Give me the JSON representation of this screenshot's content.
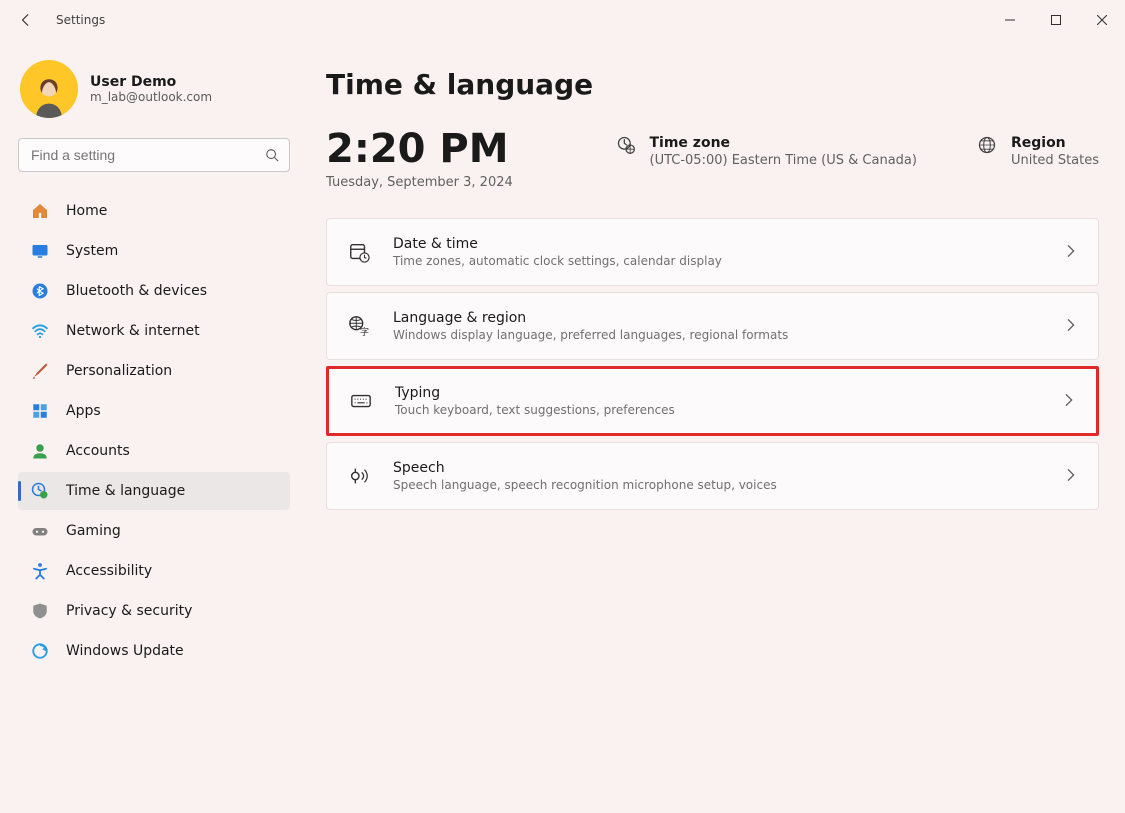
{
  "window": {
    "title": "Settings"
  },
  "profile": {
    "name": "User Demo",
    "email": "m_lab@outlook.com"
  },
  "search": {
    "placeholder": "Find a setting"
  },
  "nav": {
    "items": [
      {
        "id": "home",
        "label": "Home"
      },
      {
        "id": "system",
        "label": "System"
      },
      {
        "id": "bluetooth",
        "label": "Bluetooth & devices"
      },
      {
        "id": "network",
        "label": "Network & internet"
      },
      {
        "id": "personalization",
        "label": "Personalization"
      },
      {
        "id": "apps",
        "label": "Apps"
      },
      {
        "id": "accounts",
        "label": "Accounts"
      },
      {
        "id": "time",
        "label": "Time & language"
      },
      {
        "id": "gaming",
        "label": "Gaming"
      },
      {
        "id": "accessibility",
        "label": "Accessibility"
      },
      {
        "id": "privacy",
        "label": "Privacy & security"
      },
      {
        "id": "update",
        "label": "Windows Update"
      }
    ],
    "active_id": "time"
  },
  "page": {
    "title": "Time & language",
    "clock": {
      "time": "2:20 PM",
      "date": "Tuesday, September 3, 2024"
    },
    "timezone": {
      "label": "Time zone",
      "value": "(UTC-05:00) Eastern Time (US & Canada)"
    },
    "region": {
      "label": "Region",
      "value": "United States"
    },
    "cards": [
      {
        "id": "datetime",
        "title": "Date & time",
        "sub": "Time zones, automatic clock settings, calendar display"
      },
      {
        "id": "langregion",
        "title": "Language & region",
        "sub": "Windows display language, preferred languages, regional formats"
      },
      {
        "id": "typing",
        "title": "Typing",
        "sub": "Touch keyboard, text suggestions, preferences",
        "highlighted": true
      },
      {
        "id": "speech",
        "title": "Speech",
        "sub": "Speech language, speech recognition microphone setup, voices"
      }
    ]
  }
}
